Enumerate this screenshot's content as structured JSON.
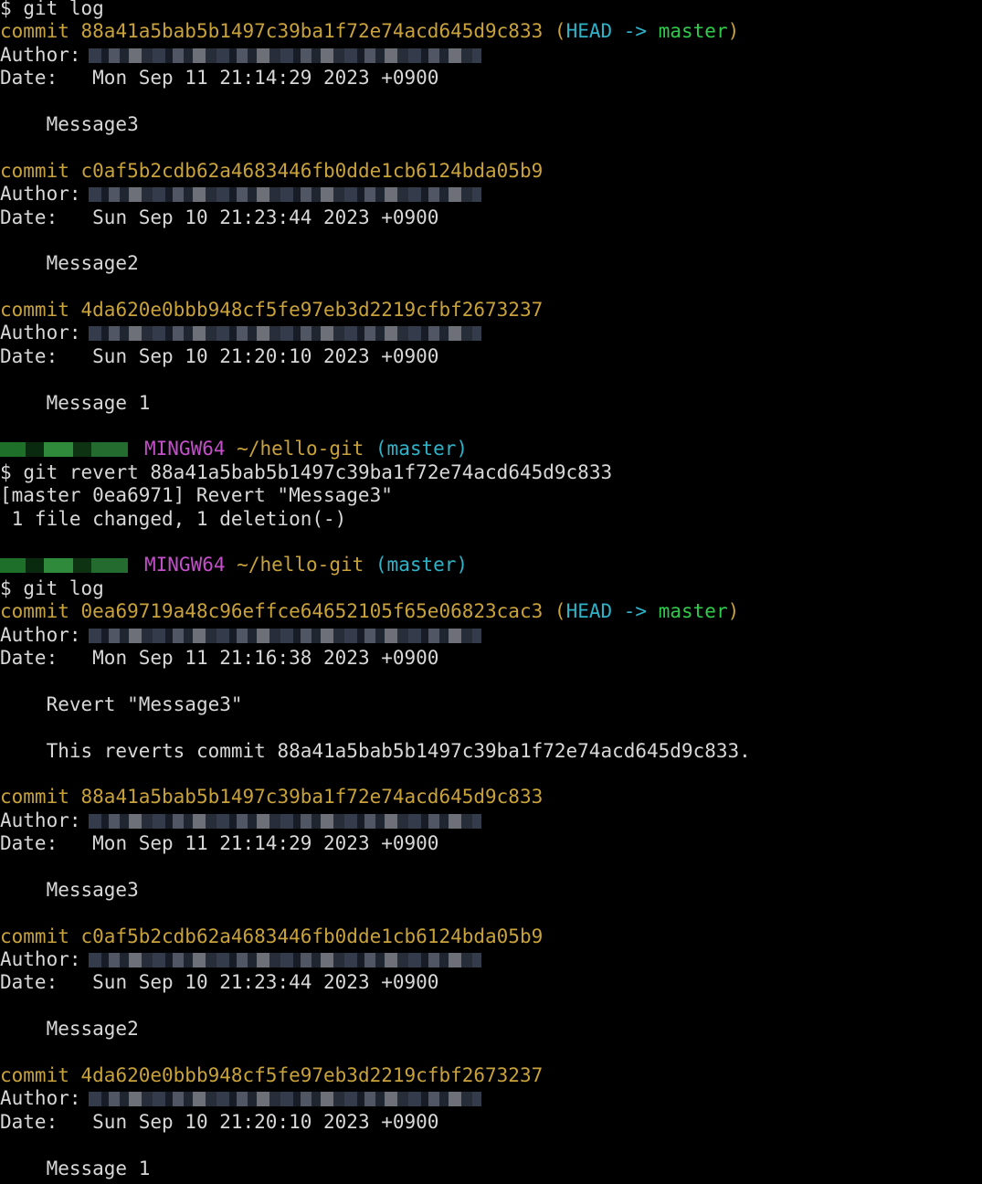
{
  "terminal": {
    "lines": [
      {
        "type": "cmd",
        "prompt": "$",
        "text": "git log"
      },
      {
        "type": "commit",
        "label": "commit",
        "hash": "88a41a5bab5b1497c39ba1f72e74acd645d9c833",
        "ref_open": "(",
        "ref_head": "HEAD ->",
        "ref_branch": "master",
        "ref_close": ")"
      },
      {
        "type": "author",
        "label": "Author:"
      },
      {
        "type": "date",
        "label": "Date:",
        "value": "Mon Sep 11 21:14:29 2023 +0900"
      },
      {
        "type": "blank"
      },
      {
        "type": "message",
        "text": "Message3"
      },
      {
        "type": "blank"
      },
      {
        "type": "commit",
        "label": "commit",
        "hash": "c0af5b2cdb62a4683446fb0dde1cb6124bda05b9"
      },
      {
        "type": "author",
        "label": "Author:"
      },
      {
        "type": "date",
        "label": "Date:",
        "value": "Sun Sep 10 21:23:44 2023 +0900"
      },
      {
        "type": "blank"
      },
      {
        "type": "message",
        "text": "Message2"
      },
      {
        "type": "blank"
      },
      {
        "type": "commit",
        "label": "commit",
        "hash": "4da620e0bbb948cf5fe97eb3d2219cfbf2673237"
      },
      {
        "type": "author",
        "label": "Author:"
      },
      {
        "type": "date",
        "label": "Date:",
        "value": "Sun Sep 10 21:20:10 2023 +0900"
      },
      {
        "type": "blank"
      },
      {
        "type": "message",
        "text": "Message 1"
      },
      {
        "type": "blank"
      },
      {
        "type": "prompt",
        "env": "MINGW64",
        "path": "~/hello-git",
        "branch": "(master)"
      },
      {
        "type": "cmd",
        "prompt": "$",
        "text": "git revert 88a41a5bab5b1497c39ba1f72e74acd645d9c833"
      },
      {
        "type": "output",
        "text": "[master 0ea6971] Revert \"Message3\""
      },
      {
        "type": "output",
        "text": " 1 file changed, 1 deletion(-)"
      },
      {
        "type": "blank"
      },
      {
        "type": "prompt",
        "env": "MINGW64",
        "path": "~/hello-git",
        "branch": "(master)"
      },
      {
        "type": "cmd",
        "prompt": "$",
        "text": "git log"
      },
      {
        "type": "commit",
        "label": "commit",
        "hash": "0ea69719a48c96effce64652105f65e06823cac3",
        "ref_open": "(",
        "ref_head": "HEAD ->",
        "ref_branch": "master",
        "ref_close": ")"
      },
      {
        "type": "author",
        "label": "Author:"
      },
      {
        "type": "date",
        "label": "Date:",
        "value": "Mon Sep 11 21:16:38 2023 +0900"
      },
      {
        "type": "blank"
      },
      {
        "type": "message",
        "text": "Revert \"Message3\""
      },
      {
        "type": "blank"
      },
      {
        "type": "message",
        "text": "This reverts commit 88a41a5bab5b1497c39ba1f72e74acd645d9c833."
      },
      {
        "type": "blank"
      },
      {
        "type": "commit",
        "label": "commit",
        "hash": "88a41a5bab5b1497c39ba1f72e74acd645d9c833"
      },
      {
        "type": "author",
        "label": "Author:"
      },
      {
        "type": "date",
        "label": "Date:",
        "value": "Mon Sep 11 21:14:29 2023 +0900"
      },
      {
        "type": "blank"
      },
      {
        "type": "message",
        "text": "Message3"
      },
      {
        "type": "blank"
      },
      {
        "type": "commit",
        "label": "commit",
        "hash": "c0af5b2cdb62a4683446fb0dde1cb6124bda05b9"
      },
      {
        "type": "author",
        "label": "Author:"
      },
      {
        "type": "date",
        "label": "Date:",
        "value": "Sun Sep 10 21:23:44 2023 +0900"
      },
      {
        "type": "blank"
      },
      {
        "type": "message",
        "text": "Message2"
      },
      {
        "type": "blank"
      },
      {
        "type": "commit",
        "label": "commit",
        "hash": "4da620e0bbb948cf5fe97eb3d2219cfbf2673237"
      },
      {
        "type": "author",
        "label": "Author:"
      },
      {
        "type": "date",
        "label": "Date:",
        "value": "Sun Sep 10 21:20:10 2023 +0900"
      },
      {
        "type": "blank"
      },
      {
        "type": "message",
        "text": "Message 1"
      }
    ]
  },
  "colors": {
    "background": "#000000",
    "text": "#d0d0d0",
    "commit": "#c9a23a",
    "head": "#2fb3c9",
    "branch": "#2ecc4a",
    "env": "#c34fc9"
  }
}
